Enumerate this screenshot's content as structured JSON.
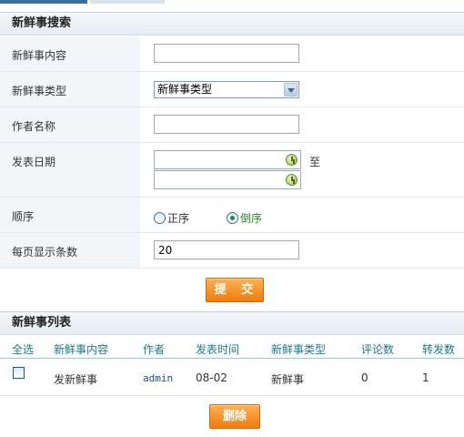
{
  "search": {
    "title": "新鲜事搜索",
    "content_label": "新鲜事内容",
    "content_value": "",
    "type_label": "新鲜事类型",
    "type_selected": "新鲜事类型",
    "author_label": "作者名称",
    "author_value": "",
    "date_label": "发表日期",
    "date_to_label": "至",
    "order_label": "顺序",
    "order_asc_label": "正序",
    "order_desc_label": "倒序",
    "order_selected": "倒序",
    "page_size_label": "每页显示条数",
    "page_size_value": "20",
    "submit_label": "提 交"
  },
  "list": {
    "title": "新鲜事列表",
    "headers": [
      "全选",
      "新鲜事内容",
      "作者",
      "发表时间",
      "新鲜事类型",
      "评论数",
      "转发数"
    ],
    "rows": [
      {
        "content": "发新鲜事",
        "author": "admin",
        "time": "08-02",
        "type": "新鲜事",
        "comments": "0",
        "forwards": "1"
      }
    ],
    "delete_label": "删除"
  },
  "colors": {
    "accent_button": "#f07a0e",
    "header_text": "#1b7a8c",
    "radio_checked": "#2d8a2d"
  }
}
